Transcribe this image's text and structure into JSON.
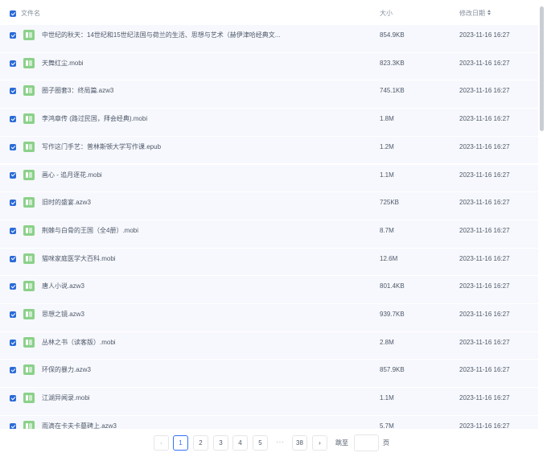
{
  "header": {
    "col_name": "文件名",
    "col_size": "大小",
    "col_date": "修改日期"
  },
  "rows": [
    {
      "name": "中世纪的秋天：14世纪和15世纪法国与荷兰的生活、思想与艺术（赫伊津哈经典文...",
      "size": "854.9KB",
      "date": "2023-11-16 16:27"
    },
    {
      "name": "天舞红尘.mobi",
      "size": "823.3KB",
      "date": "2023-11-16 16:27"
    },
    {
      "name": "圈子圈套3：终局篇.azw3",
      "size": "745.1KB",
      "date": "2023-11-16 16:27"
    },
    {
      "name": "李鸿章传 (路过民国，拜会经典).mobi",
      "size": "1.8M",
      "date": "2023-11-16 16:27"
    },
    {
      "name": "写作这门手艺：普林斯顿大学写作课.epub",
      "size": "1.2M",
      "date": "2023-11-16 16:27"
    },
    {
      "name": "画心 - 追月逐花.mobi",
      "size": "1.1M",
      "date": "2023-11-16 16:27"
    },
    {
      "name": "旧时的盛宴.azw3",
      "size": "725KB",
      "date": "2023-11-16 16:27"
    },
    {
      "name": "荆棘与白骨的王国（全4册）.mobi",
      "size": "8.7M",
      "date": "2023-11-16 16:27"
    },
    {
      "name": "猫咪家庭医学大百科.mobi",
      "size": "12.6M",
      "date": "2023-11-16 16:27"
    },
    {
      "name": "唐人小说.azw3",
      "size": "801.4KB",
      "date": "2023-11-16 16:27"
    },
    {
      "name": "思想之镜.azw3",
      "size": "939.7KB",
      "date": "2023-11-16 16:27"
    },
    {
      "name": "丛林之书（读客版）.mobi",
      "size": "2.8M",
      "date": "2023-11-16 16:27"
    },
    {
      "name": "环保的暴力.azw3",
      "size": "857.9KB",
      "date": "2023-11-16 16:27"
    },
    {
      "name": "江湖异闻录.mobi",
      "size": "1.1M",
      "date": "2023-11-16 16:27"
    },
    {
      "name": "雨滴在卡夫卡墓碑上.azw3",
      "size": "5.7M",
      "date": "2023-11-16 16:27"
    }
  ],
  "pagination": {
    "prev": "‹",
    "next": "›",
    "pages": [
      "1",
      "2",
      "3",
      "4",
      "5"
    ],
    "ellipsis": "···",
    "last": "38",
    "current": "1",
    "jump_label": "跳至",
    "jump_value": "",
    "jump_unit": "页"
  },
  "icons": {
    "file": "book-file-icon",
    "sort": "sort-icon"
  },
  "colors": {
    "accent": "#3370ff",
    "checkbox": "#2b6bd8",
    "file_icon": "#8bd18a",
    "row_bg": "#f7f8fd"
  }
}
